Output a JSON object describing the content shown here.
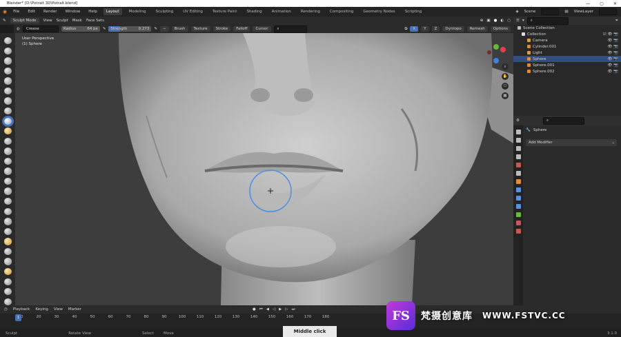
{
  "titlebar": {
    "title": "Blender* [D:\\Potrait 3D\\Potrait.blend]"
  },
  "menu": {
    "items": [
      "File",
      "Edit",
      "Render",
      "Window",
      "Help"
    ]
  },
  "workspaces": [
    "Layout",
    "Modeling",
    "Sculpting",
    "UV Editing",
    "Texture Paint",
    "Shading",
    "Animation",
    "Rendering",
    "Compositing",
    "Geometry Nodes",
    "Scripting"
  ],
  "active_workspace": "Layout",
  "scene": {
    "label": "Scene",
    "view_layer": "ViewLayer"
  },
  "viewport_header": {
    "mode": "Sculpt Mode",
    "menus": [
      "View",
      "Sculpt",
      "Mask",
      "Face Sets"
    ],
    "dyntopo": "Dyntopo",
    "remesh": "Remesh",
    "options": "Options"
  },
  "tool_settings": {
    "brush_name": "Crease",
    "radius_label": "Radius",
    "radius_value": "64 px",
    "strength_label": "Strength",
    "strength_value": "0.273",
    "strength_fraction": 0.273,
    "menus": [
      "Brush",
      "Texture",
      "Stroke",
      "Falloff",
      "Cursor"
    ],
    "axes": [
      "X",
      "Y",
      "Z"
    ]
  },
  "viewport": {
    "line1": "User Perspective",
    "line2": "(1) Sphere"
  },
  "outliner": {
    "root": "Scene Collection",
    "collection": "Collection",
    "items": [
      {
        "name": "Camera",
        "color": "#d9a04a",
        "selected": false
      },
      {
        "name": "Cylinder.001",
        "color": "#e08a3c",
        "selected": false
      },
      {
        "name": "Light",
        "color": "#d9a04a",
        "selected": false
      },
      {
        "name": "Sphere",
        "color": "#e08a3c",
        "selected": true
      },
      {
        "name": "Sphere.001",
        "color": "#e08a3c",
        "selected": false
      },
      {
        "name": "Sphere.002",
        "color": "#e08a3c",
        "selected": false
      }
    ]
  },
  "properties": {
    "object_name": "Sphere",
    "add_modifier": "Add Modifier"
  },
  "timeline": {
    "menus": [
      "Playback",
      "Keying",
      "View",
      "Marker"
    ],
    "current_frame": "1",
    "ticks": [
      "10",
      "20",
      "30",
      "40",
      "50",
      "60",
      "70",
      "80",
      "90",
      "100",
      "110",
      "120",
      "130",
      "140",
      "150",
      "160",
      "170",
      "180"
    ]
  },
  "statusbar": {
    "items": [
      "Sculpt",
      "Rotate View",
      "Select",
      "Move"
    ],
    "version": "3.1.0"
  },
  "overlay": {
    "middle_click": "Middle click"
  },
  "watermark": {
    "logo": "FS",
    "text": "梵摄创意库",
    "url": "WWW.FSTVC.CC"
  },
  "colors": {
    "accent": "#4772b3",
    "selected_row": "#334d80",
    "x_axis": "#e0414d",
    "y_axis": "#6bb73c",
    "z_axis": "#3f82d6"
  }
}
